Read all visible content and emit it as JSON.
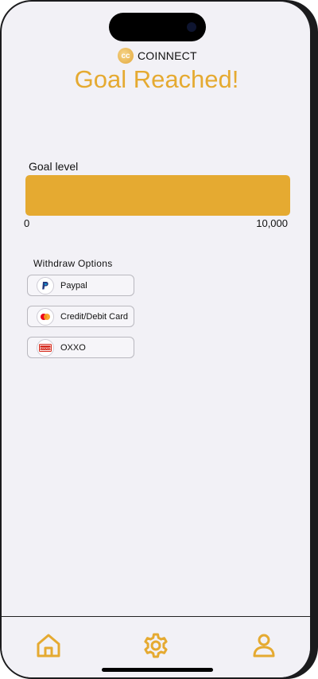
{
  "header": {
    "brand_name": "COINNECT",
    "brand_logo_text": "cc",
    "title": "Goal Reached!"
  },
  "goal": {
    "label": "Goal level",
    "min_label": "0",
    "max_label": "10,000",
    "progress_fraction": 1.0
  },
  "withdraw": {
    "title": "Withdraw Options",
    "options": [
      {
        "label": "Paypal",
        "icon": "paypal-icon"
      },
      {
        "label": "Credit/Debit Card",
        "icon": "mastercard-icon"
      },
      {
        "label": "OXXO",
        "icon": "oxxo-icon"
      }
    ]
  },
  "oxxo_logo_text": "OXXO",
  "navbar": {
    "items": [
      "home-icon",
      "gear-icon",
      "user-icon"
    ]
  },
  "colors": {
    "accent": "#e5aa31",
    "background": "#f2f1f6"
  }
}
